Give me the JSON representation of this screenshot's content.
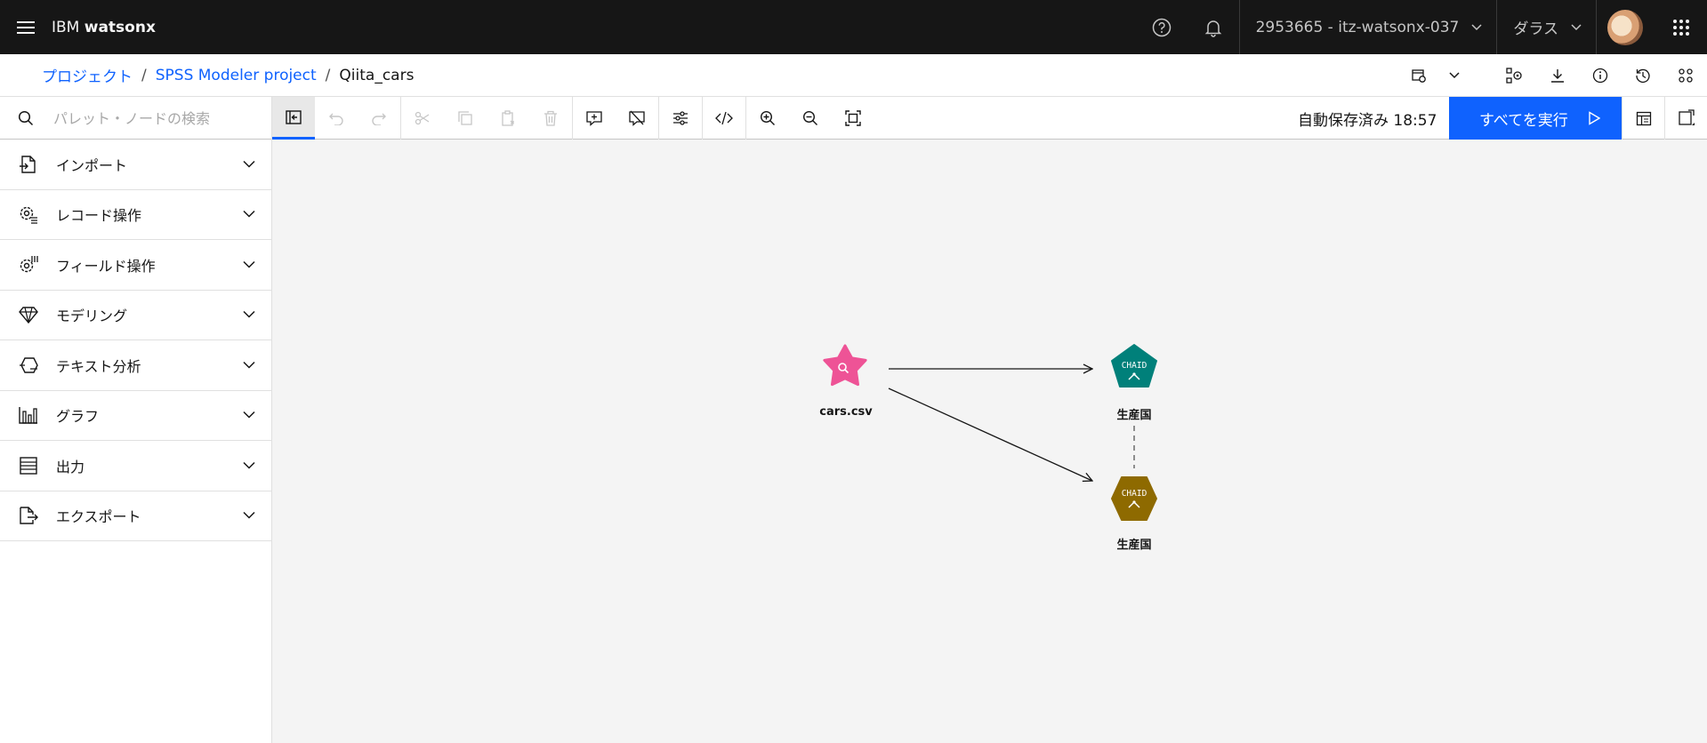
{
  "header": {
    "brand_prefix": "IBM",
    "brand_name": "watsonx",
    "account": "2953665 - itz-watsonx-037",
    "region": "ダラス"
  },
  "breadcrumb": {
    "items": [
      "プロジェクト",
      "SPSS Modeler project"
    ],
    "current": "Qiita_cars"
  },
  "search": {
    "placeholder": "パレット・ノードの検索"
  },
  "toolbar": {
    "autosave": "自動保存済み 18:57",
    "run_all": "すべてを実行"
  },
  "palette": {
    "items": [
      {
        "label": "インポート",
        "icon": "import-icon"
      },
      {
        "label": "レコード操作",
        "icon": "record-ops-icon"
      },
      {
        "label": "フィールド操作",
        "icon": "field-ops-icon"
      },
      {
        "label": "モデリング",
        "icon": "modeling-icon"
      },
      {
        "label": "テキスト分析",
        "icon": "text-analysis-icon"
      },
      {
        "label": "グラフ",
        "icon": "graph-icon"
      },
      {
        "label": "出力",
        "icon": "output-icon"
      },
      {
        "label": "エクスポート",
        "icon": "export-icon"
      }
    ]
  },
  "canvas": {
    "nodes": [
      {
        "id": "cars",
        "label": "cars.csv",
        "type": "data-source",
        "color": "#ee5396"
      },
      {
        "id": "chaid1",
        "label": "生産国",
        "type": "CHAID",
        "color": "#00807a"
      },
      {
        "id": "chaid2",
        "label": "生産国",
        "type": "CHAID",
        "color": "#8e6a00"
      }
    ],
    "chaid_glyph": "CHAID"
  },
  "colors": {
    "accent": "#0f62fe",
    "header_bg": "#161616",
    "canvas_bg": "#f4f4f4"
  }
}
